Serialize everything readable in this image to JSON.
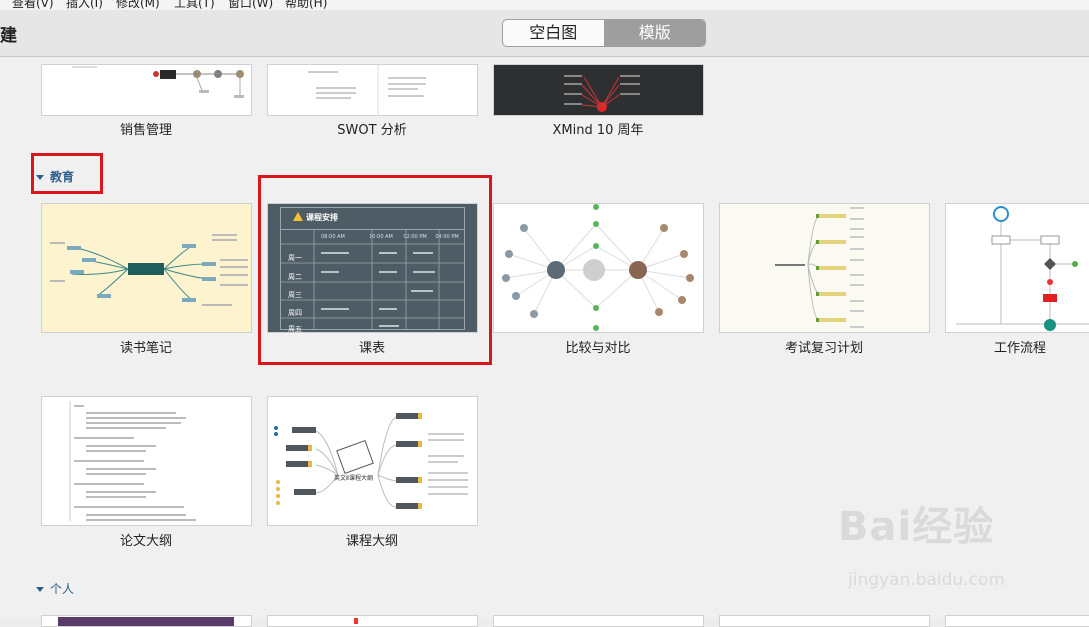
{
  "menubar": [
    "查看(V)",
    "插入(I)",
    "修改(M)",
    "工具(T)",
    "窗口(W)",
    "帮助(H)"
  ],
  "header": {
    "title": "建",
    "tab_blank": "空白图",
    "tab_template": "模版"
  },
  "top_row": [
    "销售管理",
    "SWOT 分析",
    "XMind 10 周年"
  ],
  "sections": {
    "education": "教育",
    "personal": "个人"
  },
  "education_row1": [
    "读书笔记",
    "课表",
    "比较与对比",
    "考试复习计划",
    "工作流程"
  ],
  "education_row2": [
    "论文大纲",
    "课程大纲"
  ],
  "schedule": {
    "title": "课程安排",
    "times": [
      "08:00 AM",
      "10:00 AM",
      "02:00 PM",
      "04:00 PM"
    ],
    "days": [
      "周一",
      "周二",
      "周三",
      "周四",
      "周五"
    ]
  },
  "course_outline_center": "英文Ⅱ课程大纲",
  "watermark": {
    "brand": "Bai经验",
    "url": "jingyan.baidu.com"
  }
}
